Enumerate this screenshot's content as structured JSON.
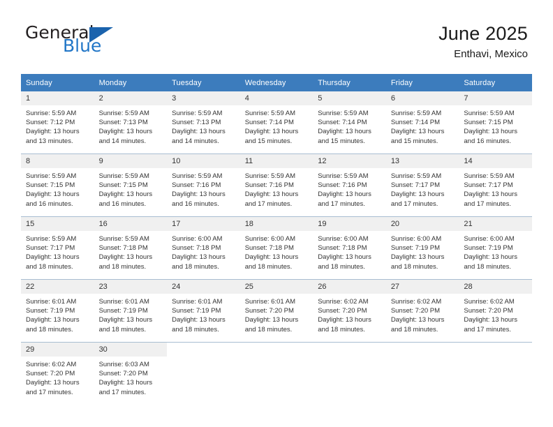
{
  "brand": {
    "name_part1": "General",
    "name_part2": "Blue",
    "logo_icon": "triangle-flag-icon",
    "accent_color": "#2176c7",
    "triangle_color": "#1b63ad"
  },
  "header": {
    "title": "June 2025",
    "subtitle": "Enthavi, Mexico"
  },
  "colors": {
    "header_row_bg": "#3c7cbd",
    "daynum_bg": "#f0f0f0",
    "grid_line": "#9fb8cf",
    "text": "#333333"
  },
  "weekday_headers": [
    "Sunday",
    "Monday",
    "Tuesday",
    "Wednesday",
    "Thursday",
    "Friday",
    "Saturday"
  ],
  "weeks": [
    [
      {
        "day": "1",
        "sunrise": "Sunrise: 5:59 AM",
        "sunset": "Sunset: 7:12 PM",
        "daylight_line1": "Daylight: 13 hours",
        "daylight_line2": "and 13 minutes."
      },
      {
        "day": "2",
        "sunrise": "Sunrise: 5:59 AM",
        "sunset": "Sunset: 7:13 PM",
        "daylight_line1": "Daylight: 13 hours",
        "daylight_line2": "and 14 minutes."
      },
      {
        "day": "3",
        "sunrise": "Sunrise: 5:59 AM",
        "sunset": "Sunset: 7:13 PM",
        "daylight_line1": "Daylight: 13 hours",
        "daylight_line2": "and 14 minutes."
      },
      {
        "day": "4",
        "sunrise": "Sunrise: 5:59 AM",
        "sunset": "Sunset: 7:14 PM",
        "daylight_line1": "Daylight: 13 hours",
        "daylight_line2": "and 15 minutes."
      },
      {
        "day": "5",
        "sunrise": "Sunrise: 5:59 AM",
        "sunset": "Sunset: 7:14 PM",
        "daylight_line1": "Daylight: 13 hours",
        "daylight_line2": "and 15 minutes."
      },
      {
        "day": "6",
        "sunrise": "Sunrise: 5:59 AM",
        "sunset": "Sunset: 7:14 PM",
        "daylight_line1": "Daylight: 13 hours",
        "daylight_line2": "and 15 minutes."
      },
      {
        "day": "7",
        "sunrise": "Sunrise: 5:59 AM",
        "sunset": "Sunset: 7:15 PM",
        "daylight_line1": "Daylight: 13 hours",
        "daylight_line2": "and 16 minutes."
      }
    ],
    [
      {
        "day": "8",
        "sunrise": "Sunrise: 5:59 AM",
        "sunset": "Sunset: 7:15 PM",
        "daylight_line1": "Daylight: 13 hours",
        "daylight_line2": "and 16 minutes."
      },
      {
        "day": "9",
        "sunrise": "Sunrise: 5:59 AM",
        "sunset": "Sunset: 7:15 PM",
        "daylight_line1": "Daylight: 13 hours",
        "daylight_line2": "and 16 minutes."
      },
      {
        "day": "10",
        "sunrise": "Sunrise: 5:59 AM",
        "sunset": "Sunset: 7:16 PM",
        "daylight_line1": "Daylight: 13 hours",
        "daylight_line2": "and 16 minutes."
      },
      {
        "day": "11",
        "sunrise": "Sunrise: 5:59 AM",
        "sunset": "Sunset: 7:16 PM",
        "daylight_line1": "Daylight: 13 hours",
        "daylight_line2": "and 17 minutes."
      },
      {
        "day": "12",
        "sunrise": "Sunrise: 5:59 AM",
        "sunset": "Sunset: 7:16 PM",
        "daylight_line1": "Daylight: 13 hours",
        "daylight_line2": "and 17 minutes."
      },
      {
        "day": "13",
        "sunrise": "Sunrise: 5:59 AM",
        "sunset": "Sunset: 7:17 PM",
        "daylight_line1": "Daylight: 13 hours",
        "daylight_line2": "and 17 minutes."
      },
      {
        "day": "14",
        "sunrise": "Sunrise: 5:59 AM",
        "sunset": "Sunset: 7:17 PM",
        "daylight_line1": "Daylight: 13 hours",
        "daylight_line2": "and 17 minutes."
      }
    ],
    [
      {
        "day": "15",
        "sunrise": "Sunrise: 5:59 AM",
        "sunset": "Sunset: 7:17 PM",
        "daylight_line1": "Daylight: 13 hours",
        "daylight_line2": "and 18 minutes."
      },
      {
        "day": "16",
        "sunrise": "Sunrise: 5:59 AM",
        "sunset": "Sunset: 7:18 PM",
        "daylight_line1": "Daylight: 13 hours",
        "daylight_line2": "and 18 minutes."
      },
      {
        "day": "17",
        "sunrise": "Sunrise: 6:00 AM",
        "sunset": "Sunset: 7:18 PM",
        "daylight_line1": "Daylight: 13 hours",
        "daylight_line2": "and 18 minutes."
      },
      {
        "day": "18",
        "sunrise": "Sunrise: 6:00 AM",
        "sunset": "Sunset: 7:18 PM",
        "daylight_line1": "Daylight: 13 hours",
        "daylight_line2": "and 18 minutes."
      },
      {
        "day": "19",
        "sunrise": "Sunrise: 6:00 AM",
        "sunset": "Sunset: 7:18 PM",
        "daylight_line1": "Daylight: 13 hours",
        "daylight_line2": "and 18 minutes."
      },
      {
        "day": "20",
        "sunrise": "Sunrise: 6:00 AM",
        "sunset": "Sunset: 7:19 PM",
        "daylight_line1": "Daylight: 13 hours",
        "daylight_line2": "and 18 minutes."
      },
      {
        "day": "21",
        "sunrise": "Sunrise: 6:00 AM",
        "sunset": "Sunset: 7:19 PM",
        "daylight_line1": "Daylight: 13 hours",
        "daylight_line2": "and 18 minutes."
      }
    ],
    [
      {
        "day": "22",
        "sunrise": "Sunrise: 6:01 AM",
        "sunset": "Sunset: 7:19 PM",
        "daylight_line1": "Daylight: 13 hours",
        "daylight_line2": "and 18 minutes."
      },
      {
        "day": "23",
        "sunrise": "Sunrise: 6:01 AM",
        "sunset": "Sunset: 7:19 PM",
        "daylight_line1": "Daylight: 13 hours",
        "daylight_line2": "and 18 minutes."
      },
      {
        "day": "24",
        "sunrise": "Sunrise: 6:01 AM",
        "sunset": "Sunset: 7:19 PM",
        "daylight_line1": "Daylight: 13 hours",
        "daylight_line2": "and 18 minutes."
      },
      {
        "day": "25",
        "sunrise": "Sunrise: 6:01 AM",
        "sunset": "Sunset: 7:20 PM",
        "daylight_line1": "Daylight: 13 hours",
        "daylight_line2": "and 18 minutes."
      },
      {
        "day": "26",
        "sunrise": "Sunrise: 6:02 AM",
        "sunset": "Sunset: 7:20 PM",
        "daylight_line1": "Daylight: 13 hours",
        "daylight_line2": "and 18 minutes."
      },
      {
        "day": "27",
        "sunrise": "Sunrise: 6:02 AM",
        "sunset": "Sunset: 7:20 PM",
        "daylight_line1": "Daylight: 13 hours",
        "daylight_line2": "and 18 minutes."
      },
      {
        "day": "28",
        "sunrise": "Sunrise: 6:02 AM",
        "sunset": "Sunset: 7:20 PM",
        "daylight_line1": "Daylight: 13 hours",
        "daylight_line2": "and 17 minutes."
      }
    ],
    [
      {
        "day": "29",
        "sunrise": "Sunrise: 6:02 AM",
        "sunset": "Sunset: 7:20 PM",
        "daylight_line1": "Daylight: 13 hours",
        "daylight_line2": "and 17 minutes."
      },
      {
        "day": "30",
        "sunrise": "Sunrise: 6:03 AM",
        "sunset": "Sunset: 7:20 PM",
        "daylight_line1": "Daylight: 13 hours",
        "daylight_line2": "and 17 minutes."
      },
      {
        "day": "",
        "sunrise": "",
        "sunset": "",
        "daylight_line1": "",
        "daylight_line2": ""
      },
      {
        "day": "",
        "sunrise": "",
        "sunset": "",
        "daylight_line1": "",
        "daylight_line2": ""
      },
      {
        "day": "",
        "sunrise": "",
        "sunset": "",
        "daylight_line1": "",
        "daylight_line2": ""
      },
      {
        "day": "",
        "sunrise": "",
        "sunset": "",
        "daylight_line1": "",
        "daylight_line2": ""
      },
      {
        "day": "",
        "sunrise": "",
        "sunset": "",
        "daylight_line1": "",
        "daylight_line2": ""
      }
    ]
  ]
}
